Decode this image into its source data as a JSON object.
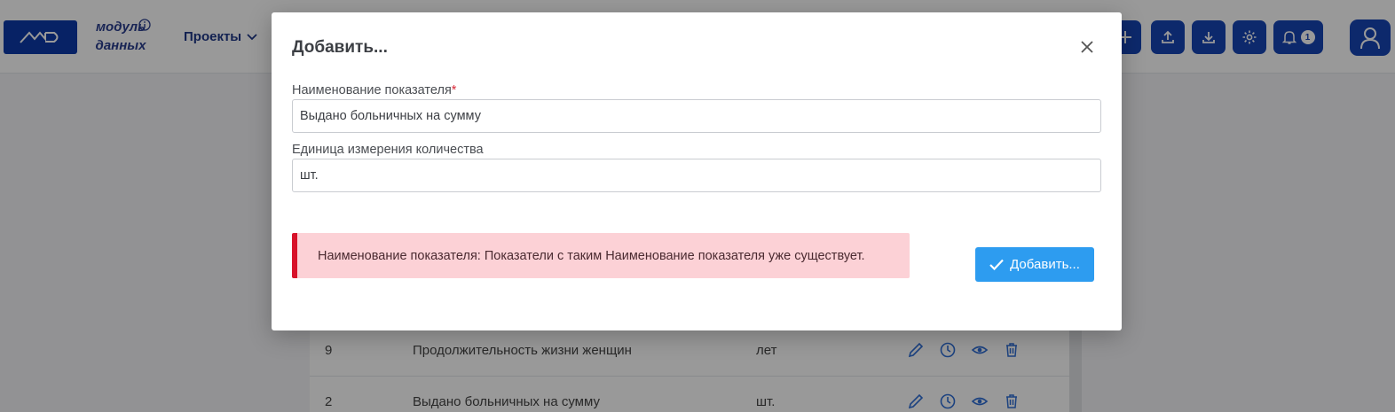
{
  "header": {
    "brand_line1": "модуль",
    "brand_line2": "данных",
    "nav_projects": "Проекты",
    "notifications_count": "1",
    "icons": [
      "logo-md",
      "info-icon",
      "chevron-down-icon",
      "plus-icon",
      "upload-icon",
      "download-icon",
      "gear-icon",
      "bell-icon",
      "user-icon"
    ]
  },
  "table": {
    "rows": [
      {
        "num": "9",
        "name": "Продолжительность жизни женщин",
        "unit": "лет"
      },
      {
        "num": "2",
        "name": "Выдано больничных на сумму",
        "unit": "шт."
      }
    ],
    "action_icons": [
      "pencil-icon",
      "clock-icon",
      "eye-icon",
      "trash-icon"
    ]
  },
  "modal": {
    "title": "Добавить...",
    "name_label": "Наименование показателя",
    "required_mark": "*",
    "name_value": "Выдано больничных на сумму",
    "unit_label": "Единица измерения количества",
    "unit_value": "шт.",
    "error_text": "Наименование показателя: Показатели с таким Наименование показателя уже существует.",
    "submit_label": "Добавить..."
  },
  "colors": {
    "primary": "#1745b5",
    "accent_button": "#2d9cf0",
    "error_bg": "#fcd1d6",
    "error_border": "#d8122a"
  }
}
